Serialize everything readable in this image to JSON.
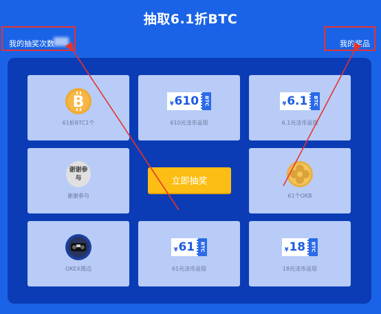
{
  "page": {
    "title": "抽取6.1折BTC",
    "draw_count_label": "我的抽奖次数",
    "my_prizes_label": "我的奖品",
    "draw_button": "立即抽奖"
  },
  "prizes": [
    {
      "label": "61折BTC1个",
      "icon": "bitcoin-icon"
    },
    {
      "label": "610元法币返现",
      "icon": "coupon-icon",
      "amount": "610",
      "tag": "BTC",
      "currency": "¥"
    },
    {
      "label": "6.1元法币返现",
      "icon": "coupon-icon",
      "amount": "6.1",
      "tag": "BTC",
      "currency": "¥"
    },
    {
      "label": "谢谢参与",
      "icon": "thanks-icon",
      "icon_text": "谢谢参与"
    },
    {
      "label": "61个OKB",
      "icon": "okb-coin-icon"
    },
    {
      "label": "OKEX周边",
      "icon": "okex-merch-icon"
    },
    {
      "label": "61元法币返现",
      "icon": "coupon-icon",
      "amount": "61",
      "tag": "BTC",
      "currency": "¥"
    },
    {
      "label": "18元法币返现",
      "icon": "coupon-icon",
      "amount": "18",
      "tag": "BTC",
      "currency": "¥"
    }
  ],
  "colors": {
    "background": "#1a63e6",
    "panel": "#0b3cb5",
    "cell": "#b8ccf7",
    "button": "#fcbe14",
    "annotation": "#e8322e"
  }
}
